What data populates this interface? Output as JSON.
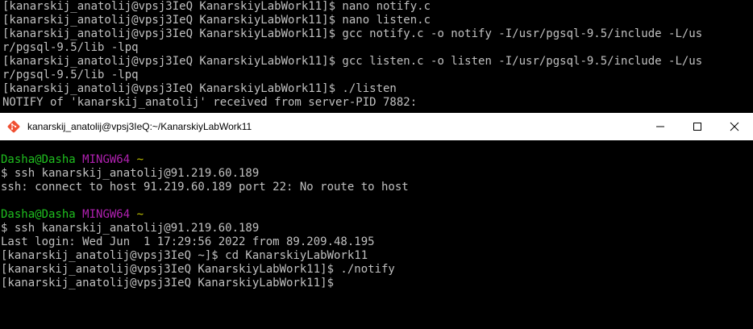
{
  "top_terminal": {
    "lines": [
      "[kanarskij_anatolij@vpsj3IeQ KanarskiyLabWork11]$ nano notify.c",
      "[kanarskij_anatolij@vpsj3IeQ KanarskiyLabWork11]$ nano listen.c",
      "[kanarskij_anatolij@vpsj3IeQ KanarskiyLabWork11]$ gcc notify.c -o notify -I/usr/pgsql-9.5/include -L/us",
      "r/pgsql-9.5/lib -lpq",
      "[kanarskij_anatolij@vpsj3IeQ KanarskiyLabWork11]$ gcc listen.c -o listen -I/usr/pgsql-9.5/include -L/us",
      "r/pgsql-9.5/lib -lpq",
      "[kanarskij_anatolij@vpsj3IeQ KanarskiyLabWork11]$ ./listen",
      "NOTIFY of 'kanarskij_anatolij' received from server-PID 7882:"
    ]
  },
  "window": {
    "title": "kanarskij_anatolij@vpsj3IeQ:~/KanarskiyLabWork11",
    "icon": "git-icon",
    "controls": {
      "minimize": "minimize-icon",
      "maximize": "maximize-icon",
      "close": "close-icon"
    }
  },
  "bottom_terminal": {
    "prompt1": {
      "user": "Dasha@Dasha",
      "env": "MINGW64",
      "path": "~"
    },
    "cmd1": "$ ssh kanarskij_anatolij@91.219.60.189",
    "out1": "ssh: connect to host 91.219.60.189 port 22: No route to host",
    "prompt2": {
      "user": "Dasha@Dasha",
      "env": "MINGW64",
      "path": "~"
    },
    "cmd2": "$ ssh kanarskij_anatolij@91.219.60.189",
    "lines_after": [
      "Last login: Wed Jun  1 17:29:56 2022 from 89.209.48.195",
      "[kanarskij_anatolij@vpsj3IeQ ~]$ cd KanarskiyLabWork11",
      "[kanarskij_anatolij@vpsj3IeQ KanarskiyLabWork11]$ ./notify",
      "[kanarskij_anatolij@vpsj3IeQ KanarskiyLabWork11]$"
    ]
  },
  "colors": {
    "terminal_bg": "#000000",
    "terminal_fg": "#c0c0c0",
    "prompt_user": "#1fbf1f",
    "prompt_env": "#b021b0",
    "prompt_path": "#c0c000",
    "titlebar_bg": "#ffffff"
  }
}
